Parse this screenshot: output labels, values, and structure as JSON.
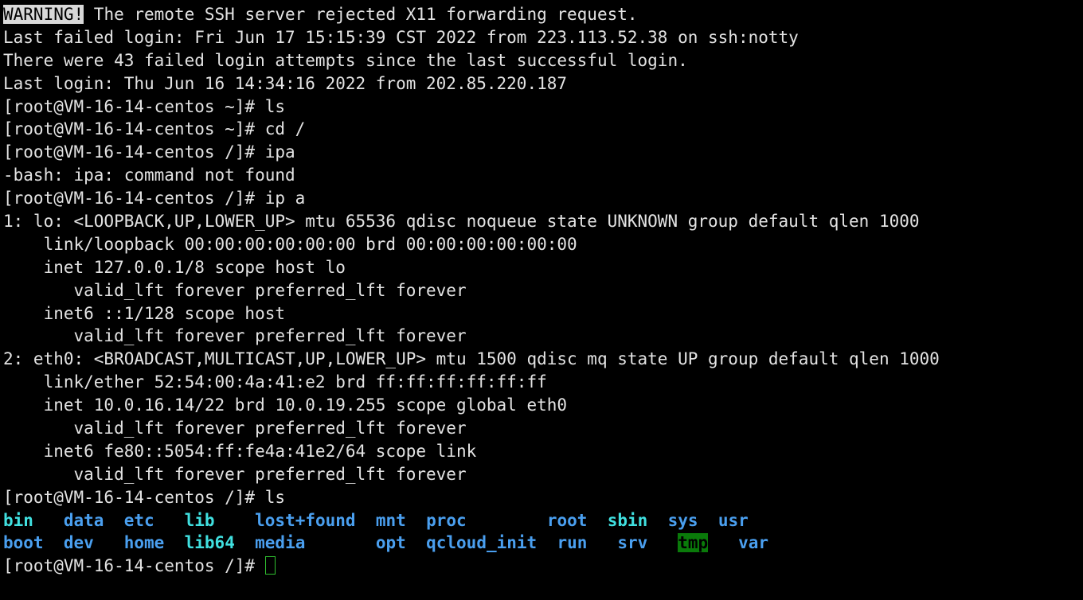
{
  "terminal": {
    "title": "root@VM-16-14-centos:/",
    "colors": {
      "background": "#000000",
      "foreground": "#e3e3e3",
      "directory_blue": "#4a9fef",
      "symlink_cyan": "#40e0e0",
      "sticky_other_writable_bg": "#0a7a0a",
      "cursor_green": "#2fbf2f",
      "inverse_bg": "#d8d8d8"
    },
    "hostname": "VM-16-14-centos",
    "user": "root",
    "prompt_home": "[root@VM-16-14-centos ~]# ",
    "prompt_root": "[root@VM-16-14-centos /]# ",
    "lines": [
      {
        "id": "warning-line",
        "segments": [
          {
            "text": "WARNING!",
            "style": "inverse"
          },
          {
            "text": " The remote SSH server rejected X11 forwarding request.",
            "style": "plain"
          }
        ]
      },
      {
        "id": "last-failed-login",
        "segments": [
          {
            "text": "Last failed login: Fri Jun 17 15:15:39 CST 2022 from 223.113.52.38 on ssh:notty",
            "style": "plain"
          }
        ]
      },
      {
        "id": "failed-attempts",
        "segments": [
          {
            "text": "There were 43 failed login attempts since the last successful login.",
            "style": "plain"
          }
        ]
      },
      {
        "id": "last-login",
        "segments": [
          {
            "text": "Last login: Thu Jun 16 14:34:16 2022 from 202.85.220.187",
            "style": "plain"
          }
        ]
      },
      {
        "id": "cmd-ls-home",
        "segments": [
          {
            "text": "[root@VM-16-14-centos ~]# ls",
            "style": "plain"
          }
        ]
      },
      {
        "id": "cmd-cd-root",
        "segments": [
          {
            "text": "[root@VM-16-14-centos ~]# cd /",
            "style": "plain"
          }
        ]
      },
      {
        "id": "cmd-ipa-typo",
        "segments": [
          {
            "text": "[root@VM-16-14-centos /]# ipa",
            "style": "plain"
          }
        ]
      },
      {
        "id": "err-command-not-found",
        "segments": [
          {
            "text": "-bash: ipa: command not found",
            "style": "plain"
          }
        ]
      },
      {
        "id": "cmd-ip-a",
        "segments": [
          {
            "text": "[root@VM-16-14-centos /]# ip a",
            "style": "plain"
          }
        ]
      },
      {
        "id": "lo-iface",
        "segments": [
          {
            "text": "1: lo: <LOOPBACK,UP,LOWER_UP> mtu 65536 qdisc noqueue state UNKNOWN group default qlen 1000",
            "style": "plain"
          }
        ]
      },
      {
        "id": "lo-link",
        "segments": [
          {
            "text": "    link/loopback 00:00:00:00:00:00 brd 00:00:00:00:00:00",
            "style": "plain"
          }
        ]
      },
      {
        "id": "lo-inet",
        "segments": [
          {
            "text": "    inet 127.0.0.1/8 scope host lo",
            "style": "plain"
          }
        ]
      },
      {
        "id": "lo-inet-lft",
        "segments": [
          {
            "text": "       valid_lft forever preferred_lft forever",
            "style": "plain"
          }
        ]
      },
      {
        "id": "lo-inet6",
        "segments": [
          {
            "text": "    inet6 ::1/128 scope host",
            "style": "plain"
          }
        ]
      },
      {
        "id": "lo-inet6-lft",
        "segments": [
          {
            "text": "       valid_lft forever preferred_lft forever",
            "style": "plain"
          }
        ]
      },
      {
        "id": "eth0-iface",
        "segments": [
          {
            "text": "2: eth0: <BROADCAST,MULTICAST,UP,LOWER_UP> mtu 1500 qdisc mq state UP group default qlen 1000",
            "style": "plain"
          }
        ]
      },
      {
        "id": "eth0-link",
        "segments": [
          {
            "text": "    link/ether 52:54:00:4a:41:e2 brd ff:ff:ff:ff:ff:ff",
            "style": "plain"
          }
        ]
      },
      {
        "id": "eth0-inet",
        "segments": [
          {
            "text": "    inet 10.0.16.14/22 brd 10.0.19.255 scope global eth0",
            "style": "plain"
          }
        ]
      },
      {
        "id": "eth0-inet-lft",
        "segments": [
          {
            "text": "       valid_lft forever preferred_lft forever",
            "style": "plain"
          }
        ]
      },
      {
        "id": "eth0-inet6",
        "segments": [
          {
            "text": "    inet6 fe80::5054:ff:fe4a:41e2/64 scope link",
            "style": "plain"
          }
        ]
      },
      {
        "id": "eth0-inet6-lft",
        "segments": [
          {
            "text": "       valid_lft forever preferred_lft forever",
            "style": "plain"
          }
        ]
      },
      {
        "id": "cmd-ls-root",
        "segments": [
          {
            "text": "[root@VM-16-14-centos /]# ls",
            "style": "plain"
          }
        ]
      },
      {
        "id": "ls-row-1",
        "segments": [
          {
            "text": "bin",
            "style": "link"
          },
          {
            "text": "   ",
            "style": "plain"
          },
          {
            "text": "data",
            "style": "dir"
          },
          {
            "text": "  ",
            "style": "plain"
          },
          {
            "text": "etc",
            "style": "dir"
          },
          {
            "text": "   ",
            "style": "plain"
          },
          {
            "text": "lib",
            "style": "link"
          },
          {
            "text": "    ",
            "style": "plain"
          },
          {
            "text": "lost+found",
            "style": "dir"
          },
          {
            "text": "  ",
            "style": "plain"
          },
          {
            "text": "mnt",
            "style": "dir"
          },
          {
            "text": "  ",
            "style": "plain"
          },
          {
            "text": "proc",
            "style": "dir"
          },
          {
            "text": "        ",
            "style": "plain"
          },
          {
            "text": "root",
            "style": "dir"
          },
          {
            "text": "  ",
            "style": "plain"
          },
          {
            "text": "sbin",
            "style": "link"
          },
          {
            "text": "  ",
            "style": "plain"
          },
          {
            "text": "sys",
            "style": "dir"
          },
          {
            "text": "  ",
            "style": "plain"
          },
          {
            "text": "usr",
            "style": "dir"
          }
        ]
      },
      {
        "id": "ls-row-2",
        "segments": [
          {
            "text": "boot",
            "style": "dir"
          },
          {
            "text": "  ",
            "style": "plain"
          },
          {
            "text": "dev",
            "style": "dir"
          },
          {
            "text": "   ",
            "style": "plain"
          },
          {
            "text": "home",
            "style": "dir"
          },
          {
            "text": "  ",
            "style": "plain"
          },
          {
            "text": "lib64",
            "style": "link"
          },
          {
            "text": "  ",
            "style": "plain"
          },
          {
            "text": "media",
            "style": "dir"
          },
          {
            "text": "       ",
            "style": "plain"
          },
          {
            "text": "opt",
            "style": "dir"
          },
          {
            "text": "  ",
            "style": "plain"
          },
          {
            "text": "qcloud_init",
            "style": "dir"
          },
          {
            "text": "  ",
            "style": "plain"
          },
          {
            "text": "run",
            "style": "dir"
          },
          {
            "text": "   ",
            "style": "plain"
          },
          {
            "text": "srv",
            "style": "dir"
          },
          {
            "text": "   ",
            "style": "plain"
          },
          {
            "text": "tmp",
            "style": "stickyw"
          },
          {
            "text": "   ",
            "style": "plain"
          },
          {
            "text": "var",
            "style": "dir"
          }
        ]
      },
      {
        "id": "final-prompt",
        "segments": [
          {
            "text": "[root@VM-16-14-centos /]# ",
            "style": "plain"
          }
        ],
        "cursor": true
      }
    ],
    "ls_listing": {
      "symlinks": [
        "bin",
        "lib",
        "lib64",
        "sbin"
      ],
      "directories": [
        "data",
        "etc",
        "lost+found",
        "mnt",
        "proc",
        "root",
        "sys",
        "usr",
        "boot",
        "dev",
        "home",
        "media",
        "opt",
        "qcloud_init",
        "run",
        "srv",
        "var"
      ],
      "sticky_other_writable": [
        "tmp"
      ]
    }
  }
}
